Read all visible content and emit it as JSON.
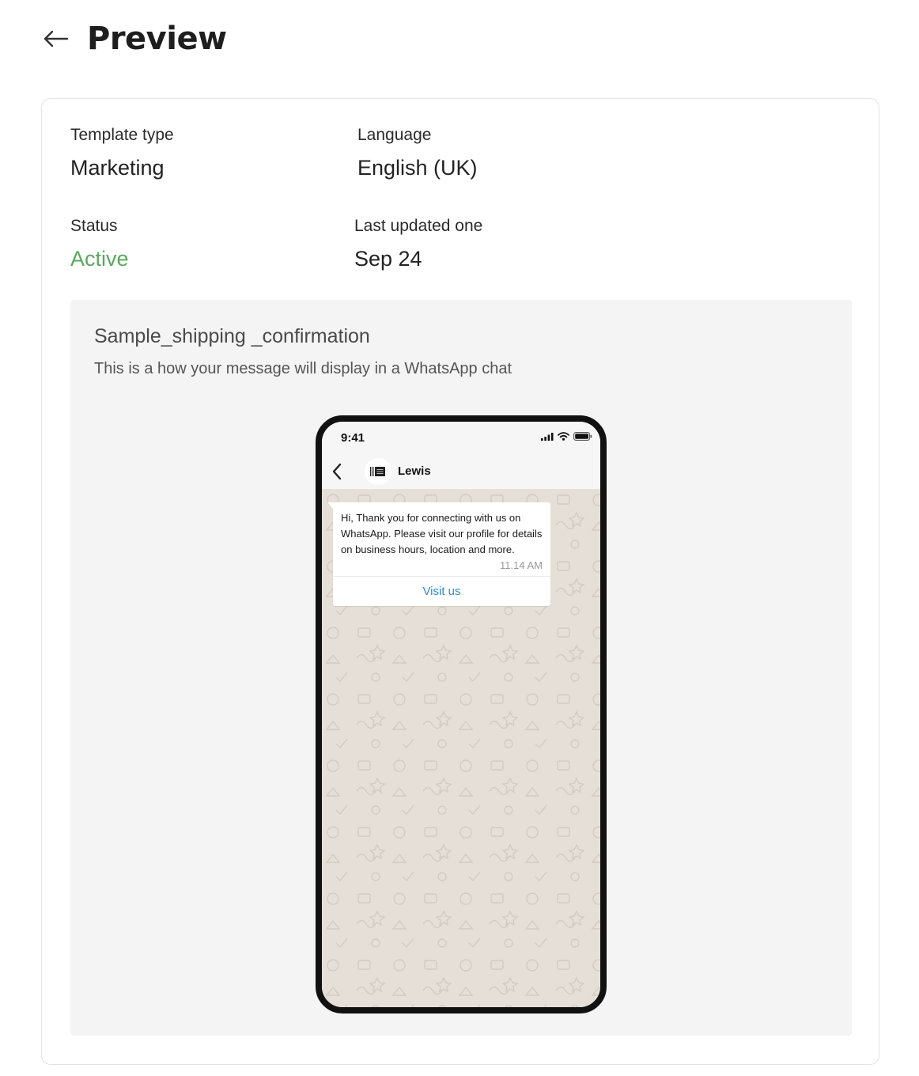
{
  "header": {
    "title": "Preview"
  },
  "details": {
    "template_type_label": "Template type",
    "template_type_value": "Marketing",
    "language_label": "Language",
    "language_value": "English (UK)",
    "status_label": "Status",
    "status_value": "Active",
    "updated_label": "Last updated one",
    "updated_value": "Sep 24"
  },
  "preview": {
    "template_name": "Sample_shipping _confirmation",
    "description": "This is a how your message will display in a WhatsApp chat"
  },
  "phone": {
    "time": "9:41",
    "contact_name": "Lewis",
    "message_text": "Hi, Thank you for connecting with us on WhatsApp. Please visit our profile for details on business hours, location and more.",
    "message_time": "11.14 AM",
    "button_label": "Visit us"
  },
  "colors": {
    "active_status": "#5aa85e",
    "link": "#2a8fcf",
    "chat_wallpaper": "#e6dfd7",
    "preview_background": "#f4f4f4"
  },
  "icons": {
    "back": "arrow-left-icon",
    "chat_back": "chevron-left-icon",
    "signal": "signal-icon",
    "wifi": "wifi-icon",
    "battery": "battery-icon",
    "avatar": "business-logo-icon"
  }
}
